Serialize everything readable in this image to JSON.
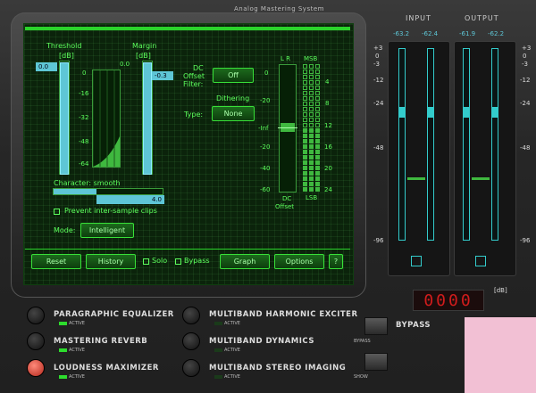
{
  "app": {
    "brand": "Analog Mastering System"
  },
  "maximizer": {
    "threshold_label": "Threshold",
    "threshold_unit": "[dB]",
    "threshold_value": "0.0",
    "margin_label": "Margin",
    "margin_unit": "[dB]",
    "margin_top": "0.0",
    "margin_value": "-0.3",
    "scale": [
      "0",
      "-16",
      "-32",
      "-48",
      "-64"
    ],
    "character_label": "Character: smooth",
    "character_value": "4.0",
    "prevent_clips_label": "Prevent inter-sample clips",
    "mode_label": "Mode:",
    "mode_value": "Intelligent"
  },
  "dither": {
    "dc_offset_label_1": "DC",
    "dc_offset_label_2": "Offset",
    "dc_offset_label_3": "Filter:",
    "dc_offset_value": "Off",
    "dithering_label": "Dithering",
    "type_label": "Type:",
    "type_value": "None",
    "lr_label": "L R",
    "msb_label": "MSB",
    "lsb_label": "LSB",
    "dc_label": "DC",
    "offset_label": "Offset",
    "db_scale": [
      "0",
      "-20",
      "-Inf",
      "-20",
      "-40",
      "-60"
    ],
    "bit_scale": [
      "4",
      "8",
      "12",
      "16",
      "20",
      "24"
    ]
  },
  "footer": {
    "reset": "Reset",
    "history": "History",
    "solo": "Solo",
    "bypass": "Bypass",
    "graph": "Graph",
    "options": "Options",
    "help": "?"
  },
  "meters": {
    "input_label": "INPUT",
    "output_label": "OUTPUT",
    "input_l": "-63.2",
    "input_r": "-62.4",
    "output_l": "-61.9",
    "output_r": "-62.2",
    "scale": [
      "+3",
      "0",
      "-3",
      "-6",
      "-12",
      "-24",
      "-48",
      "-96"
    ],
    "db_unit": "[dB]",
    "readout": "0000"
  },
  "modules": [
    {
      "name": "PARAGRAPHIC EQUALIZER",
      "status": "ACTIVE"
    },
    {
      "name": "MASTERING REVERB",
      "status": "ACTIVE"
    },
    {
      "name": "LOUDNESS MAXIMIZER",
      "status": "ACTIVE"
    },
    {
      "name": "MULTIBAND HARMONIC EXCITER",
      "status": "ACTIVE"
    },
    {
      "name": "MULTIBAND DYNAMICS",
      "status": "ACTIVE"
    },
    {
      "name": "MULTIBAND STEREO IMAGING",
      "status": "ACTIVE"
    }
  ],
  "side": {
    "bypass_title": "BYPASS",
    "bypass_small": "BYPASS",
    "show_small": "SHOW"
  },
  "colors": {
    "screen_green": "#5cff5c",
    "fader_cyan": "#5ec6d6",
    "knob_red": "#b3261b",
    "pink_overlay": "#f2c0d4"
  }
}
